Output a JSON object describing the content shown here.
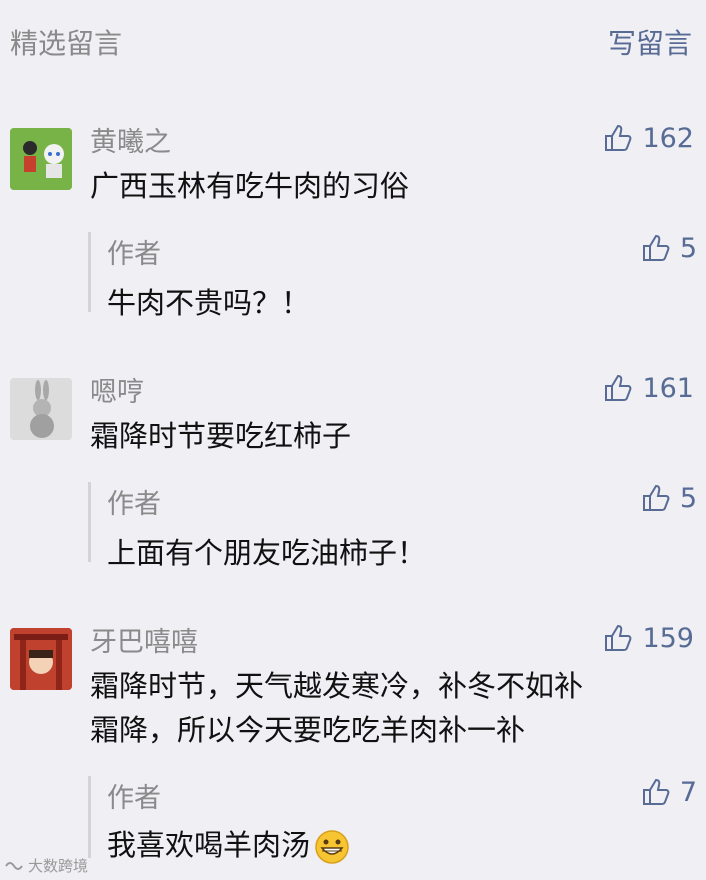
{
  "header": {
    "title": "精选留言",
    "write_label": "写留言"
  },
  "comments": [
    {
      "author": "黄曦之",
      "likes": "162",
      "text_lines": [
        "广西玉林有吃牛肉的习俗"
      ],
      "reply": {
        "author": "作者",
        "likes": "5",
        "text": "牛肉不贵吗？！"
      }
    },
    {
      "author": "嗯哼",
      "likes": "161",
      "text_lines": [
        "霜降时节要吃红柿子"
      ],
      "reply": {
        "author": "作者",
        "likes": "5",
        "text": "上面有个朋友吃油柿子！"
      }
    },
    {
      "author": "牙巴嘻嘻",
      "likes": "159",
      "text_lines": [
        "霜降时节，天气越发寒冷，补冬不如补",
        "霜降，所以今天要吃吃羊肉补一补"
      ],
      "reply": {
        "author": "作者",
        "likes": "7",
        "text": "我喜欢喝羊肉汤"
      }
    }
  ],
  "watermark": "大数跨境",
  "icons": {
    "like": "thumbs-up-icon",
    "emoji": "grinning-face-icon"
  },
  "colors": {
    "link": "#576b95",
    "muted": "#8a8a8a",
    "background": "#efeff4"
  }
}
